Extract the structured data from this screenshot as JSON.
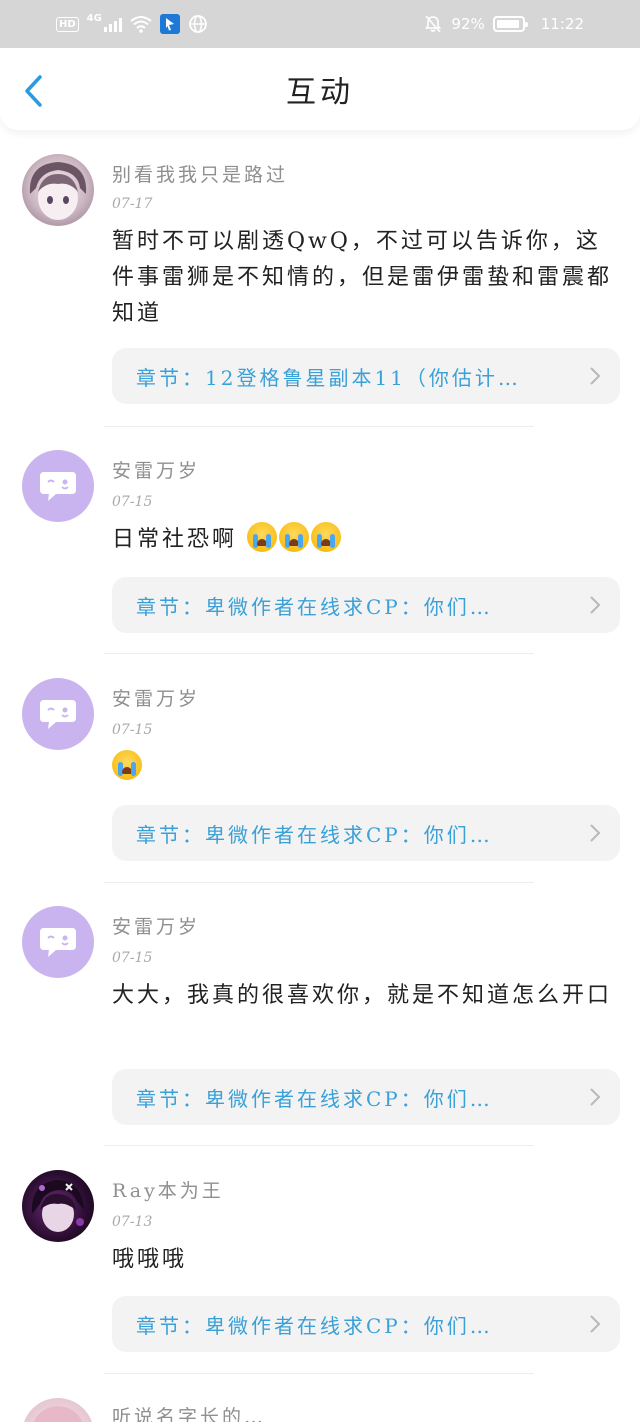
{
  "status_bar": {
    "hd": "HD",
    "network": "4G",
    "battery": "92%",
    "battery_level": 0.92,
    "time": "11:22"
  },
  "header": {
    "title": "互动"
  },
  "comments": [
    {
      "username": "别看我我只是路过",
      "date": "07-17",
      "content": "暂时不可以剧透QwQ，不过可以告诉你，这件事雷狮是不知情的，但是雷伊雷蛰和雷震都知道",
      "chapter": "章节：12登格鲁星副本11（你估计…",
      "avatar": "anime-boy-avatar"
    },
    {
      "username": "安雷万岁",
      "date": "07-15",
      "content": "日常社恐啊",
      "emoji_count": 3,
      "chapter": "章节：卑微作者在线求CP：你们…",
      "avatar": "chat-bubble-avatar"
    },
    {
      "username": "安雷万岁",
      "date": "07-15",
      "content": "",
      "emoji_count": 1,
      "chapter": "章节：卑微作者在线求CP：你们…",
      "avatar": "chat-bubble-avatar"
    },
    {
      "username": "安雷万岁",
      "date": "07-15",
      "content": "大大，我真的很喜欢你，就是不知道怎么开口",
      "chapter": "章节：卑微作者在线求CP：你们…",
      "avatar": "chat-bubble-avatar"
    },
    {
      "username": "Ray本为王",
      "date": "07-13",
      "content": "哦哦哦",
      "chapter": "章节：卑微作者在线求CP：你们…",
      "avatar": "dark-anime-avatar"
    },
    {
      "username": "听说名字长的…",
      "avatar": "pink-anime-avatar"
    }
  ],
  "colors": {
    "accent": "#3aa0d8",
    "status_bar": "#d6d6d6",
    "chat_avatar": "#c9b4f0",
    "chapter_bg": "#f3f3f3"
  }
}
